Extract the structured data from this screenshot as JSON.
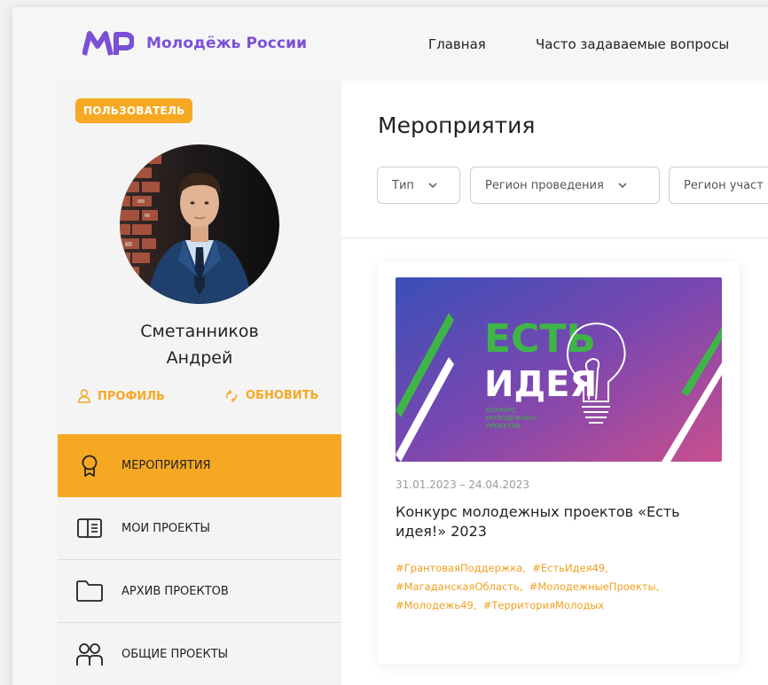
{
  "header": {
    "logo_text": "Молодёжь России",
    "nav": [
      "Главная",
      "Часто задаваемые вопросы"
    ]
  },
  "sidebar": {
    "role_badge": "ПОЛЬЗОВАТЕЛЬ",
    "user_first_line": "Сметанников",
    "user_second_line": "Андрей",
    "profile_action": "ПРОФИЛЬ",
    "refresh_action": "ОБНОВИТЬ",
    "menu": [
      {
        "label": "МЕРОПРИЯТИЯ",
        "icon": "award-icon",
        "active": true
      },
      {
        "label": "МОИ ПРОЕКТЫ",
        "icon": "project-book-icon",
        "active": false
      },
      {
        "label": "АРХИВ ПРОЕКТОВ",
        "icon": "folder-icon",
        "active": false
      },
      {
        "label": "ОБЩИЕ ПРОЕКТЫ",
        "icon": "users-icon",
        "active": false
      }
    ]
  },
  "main": {
    "title": "Мероприятия",
    "filters": [
      "Тип",
      "Регион проведения",
      "Регион участ"
    ],
    "event": {
      "image_text_line1": "ЕСТЬ",
      "image_text_line2": "ИДЕЯ",
      "image_small_1": "КОНКУРС",
      "image_small_2": "МОЛОДЕЖНЫХ",
      "image_small_3": "ПРОЕКТОВ",
      "dates": "31.01.2023 – 24.04.2023",
      "title": "Конкурс молодежных проектов «Есть идея!» 2023",
      "tags": [
        "#ГрантоваяПоддержка,",
        "#ЕстьИдея49,",
        "#МагаданскаяОбласть,",
        "#МолодежныеПроекты,",
        "#Молодежь49,",
        "#ТерриторияМолодых"
      ]
    }
  },
  "colors": {
    "accent": "#f7a823",
    "brand_purple": "#7b4fd6",
    "event_green": "#3fb548"
  }
}
